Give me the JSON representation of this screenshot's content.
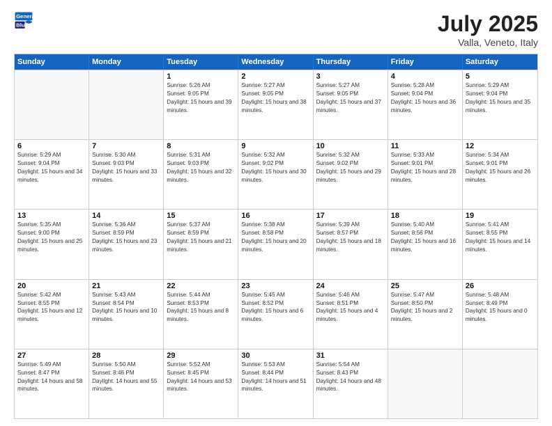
{
  "header": {
    "logo_line1": "General",
    "logo_line2": "Blue",
    "month": "July 2025",
    "location": "Valla, Veneto, Italy"
  },
  "weekdays": [
    "Sunday",
    "Monday",
    "Tuesday",
    "Wednesday",
    "Thursday",
    "Friday",
    "Saturday"
  ],
  "rows": [
    [
      {
        "day": "",
        "info": ""
      },
      {
        "day": "",
        "info": ""
      },
      {
        "day": "1",
        "info": "Sunrise: 5:26 AM\nSunset: 9:05 PM\nDaylight: 15 hours and 39 minutes."
      },
      {
        "day": "2",
        "info": "Sunrise: 5:27 AM\nSunset: 9:05 PM\nDaylight: 15 hours and 38 minutes."
      },
      {
        "day": "3",
        "info": "Sunrise: 5:27 AM\nSunset: 9:05 PM\nDaylight: 15 hours and 37 minutes."
      },
      {
        "day": "4",
        "info": "Sunrise: 5:28 AM\nSunset: 9:04 PM\nDaylight: 15 hours and 36 minutes."
      },
      {
        "day": "5",
        "info": "Sunrise: 5:29 AM\nSunset: 9:04 PM\nDaylight: 15 hours and 35 minutes."
      }
    ],
    [
      {
        "day": "6",
        "info": "Sunrise: 5:29 AM\nSunset: 9:04 PM\nDaylight: 15 hours and 34 minutes."
      },
      {
        "day": "7",
        "info": "Sunrise: 5:30 AM\nSunset: 9:03 PM\nDaylight: 15 hours and 33 minutes."
      },
      {
        "day": "8",
        "info": "Sunrise: 5:31 AM\nSunset: 9:03 PM\nDaylight: 15 hours and 32 minutes."
      },
      {
        "day": "9",
        "info": "Sunrise: 5:32 AM\nSunset: 9:02 PM\nDaylight: 15 hours and 30 minutes."
      },
      {
        "day": "10",
        "info": "Sunrise: 5:32 AM\nSunset: 9:02 PM\nDaylight: 15 hours and 29 minutes."
      },
      {
        "day": "11",
        "info": "Sunrise: 5:33 AM\nSunset: 9:01 PM\nDaylight: 15 hours and 28 minutes."
      },
      {
        "day": "12",
        "info": "Sunrise: 5:34 AM\nSunset: 9:01 PM\nDaylight: 15 hours and 26 minutes."
      }
    ],
    [
      {
        "day": "13",
        "info": "Sunrise: 5:35 AM\nSunset: 9:00 PM\nDaylight: 15 hours and 25 minutes."
      },
      {
        "day": "14",
        "info": "Sunrise: 5:36 AM\nSunset: 8:59 PM\nDaylight: 15 hours and 23 minutes."
      },
      {
        "day": "15",
        "info": "Sunrise: 5:37 AM\nSunset: 8:59 PM\nDaylight: 15 hours and 21 minutes."
      },
      {
        "day": "16",
        "info": "Sunrise: 5:38 AM\nSunset: 8:58 PM\nDaylight: 15 hours and 20 minutes."
      },
      {
        "day": "17",
        "info": "Sunrise: 5:39 AM\nSunset: 8:57 PM\nDaylight: 15 hours and 18 minutes."
      },
      {
        "day": "18",
        "info": "Sunrise: 5:40 AM\nSunset: 8:56 PM\nDaylight: 15 hours and 16 minutes."
      },
      {
        "day": "19",
        "info": "Sunrise: 5:41 AM\nSunset: 8:55 PM\nDaylight: 15 hours and 14 minutes."
      }
    ],
    [
      {
        "day": "20",
        "info": "Sunrise: 5:42 AM\nSunset: 8:55 PM\nDaylight: 15 hours and 12 minutes."
      },
      {
        "day": "21",
        "info": "Sunrise: 5:43 AM\nSunset: 8:54 PM\nDaylight: 15 hours and 10 minutes."
      },
      {
        "day": "22",
        "info": "Sunrise: 5:44 AM\nSunset: 8:53 PM\nDaylight: 15 hours and 8 minutes."
      },
      {
        "day": "23",
        "info": "Sunrise: 5:45 AM\nSunset: 8:52 PM\nDaylight: 15 hours and 6 minutes."
      },
      {
        "day": "24",
        "info": "Sunrise: 5:46 AM\nSunset: 8:51 PM\nDaylight: 15 hours and 4 minutes."
      },
      {
        "day": "25",
        "info": "Sunrise: 5:47 AM\nSunset: 8:50 PM\nDaylight: 15 hours and 2 minutes."
      },
      {
        "day": "26",
        "info": "Sunrise: 5:48 AM\nSunset: 8:49 PM\nDaylight: 15 hours and 0 minutes."
      }
    ],
    [
      {
        "day": "27",
        "info": "Sunrise: 5:49 AM\nSunset: 8:47 PM\nDaylight: 14 hours and 58 minutes."
      },
      {
        "day": "28",
        "info": "Sunrise: 5:50 AM\nSunset: 8:46 PM\nDaylight: 14 hours and 55 minutes."
      },
      {
        "day": "29",
        "info": "Sunrise: 5:52 AM\nSunset: 8:45 PM\nDaylight: 14 hours and 53 minutes."
      },
      {
        "day": "30",
        "info": "Sunrise: 5:53 AM\nSunset: 8:44 PM\nDaylight: 14 hours and 51 minutes."
      },
      {
        "day": "31",
        "info": "Sunrise: 5:54 AM\nSunset: 8:43 PM\nDaylight: 14 hours and 48 minutes."
      },
      {
        "day": "",
        "info": ""
      },
      {
        "day": "",
        "info": ""
      }
    ]
  ]
}
